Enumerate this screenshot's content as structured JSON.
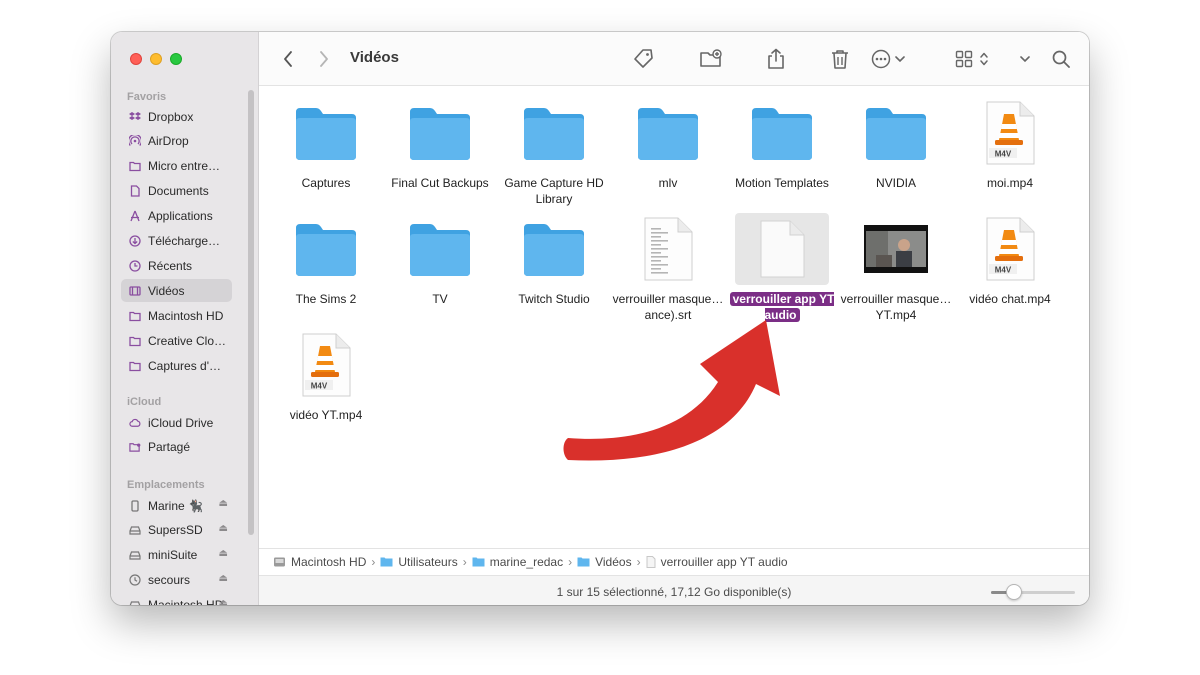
{
  "window": {
    "title": "Vidéos"
  },
  "sidebar": {
    "favorites_heading": "Favoris",
    "favorites": [
      {
        "label": "Dropbox",
        "icon": "dropbox-icon"
      },
      {
        "label": "AirDrop",
        "icon": "airdrop-icon"
      },
      {
        "label": "Micro entre…",
        "icon": "folder-icon"
      },
      {
        "label": "Documents",
        "icon": "document-icon"
      },
      {
        "label": "Applications",
        "icon": "applications-icon"
      },
      {
        "label": "Télécharge…",
        "icon": "download-icon"
      },
      {
        "label": "Récents",
        "icon": "clock-icon"
      },
      {
        "label": "Vidéos",
        "icon": "film-icon",
        "active": true
      },
      {
        "label": "Macintosh HD",
        "icon": "folder-icon"
      },
      {
        "label": "Creative Clo…",
        "icon": "folder-icon"
      },
      {
        "label": "Captures d'…",
        "icon": "folder-icon"
      }
    ],
    "icloud_heading": "iCloud",
    "icloud": [
      {
        "label": "iCloud Drive",
        "icon": "cloud-icon"
      },
      {
        "label": "Partagé",
        "icon": "shared-folder-icon"
      }
    ],
    "locations_heading": "Emplacements",
    "locations": [
      {
        "label": "Marine 🐈‍⬛",
        "icon": "phone-icon"
      },
      {
        "label": "SupersSD",
        "icon": "drive-icon"
      },
      {
        "label": "miniSuite",
        "icon": "drive-icon"
      },
      {
        "label": "secours",
        "icon": "time-machine-icon"
      },
      {
        "label": "Macintosh HD",
        "icon": "drive-icon"
      }
    ]
  },
  "files": [
    {
      "name": "Captures",
      "type": "folder"
    },
    {
      "name": "Final Cut Backups",
      "type": "folder"
    },
    {
      "name": "Game Capture HD Library",
      "type": "folder"
    },
    {
      "name": "mlv",
      "type": "folder"
    },
    {
      "name": "Motion Templates",
      "type": "folder"
    },
    {
      "name": "NVIDIA",
      "type": "folder"
    },
    {
      "name": "moi.mp4",
      "type": "vlc",
      "badge": "M4V"
    },
    {
      "name": "The Sims 2",
      "type": "folder"
    },
    {
      "name": "TV",
      "type": "folder"
    },
    {
      "name": "Twitch Studio",
      "type": "folder"
    },
    {
      "name": "verrouiller masque…ance).srt",
      "type": "text"
    },
    {
      "name": "verrouiller app YT audio",
      "type": "blank",
      "selected": true
    },
    {
      "name": "verrouiller masque…YT.mp4",
      "type": "video"
    },
    {
      "name": "vidéo chat.mp4",
      "type": "vlc",
      "badge": "M4V"
    },
    {
      "name": "vidéo YT.mp4",
      "type": "vlc",
      "badge": "M4V"
    }
  ],
  "pathbar": [
    "Macintosh HD",
    "Utilisateurs",
    "marine_redac",
    "Vidéos",
    "verrouiller app YT audio"
  ],
  "status": {
    "text": "1 sur 15 sélectionné, 17,12 Go disponible(s)",
    "zoom_fraction": 0.27
  },
  "colors": {
    "folder": "#5fb6ee",
    "selection": "#7b2e86",
    "arrow": "#d9302b"
  }
}
